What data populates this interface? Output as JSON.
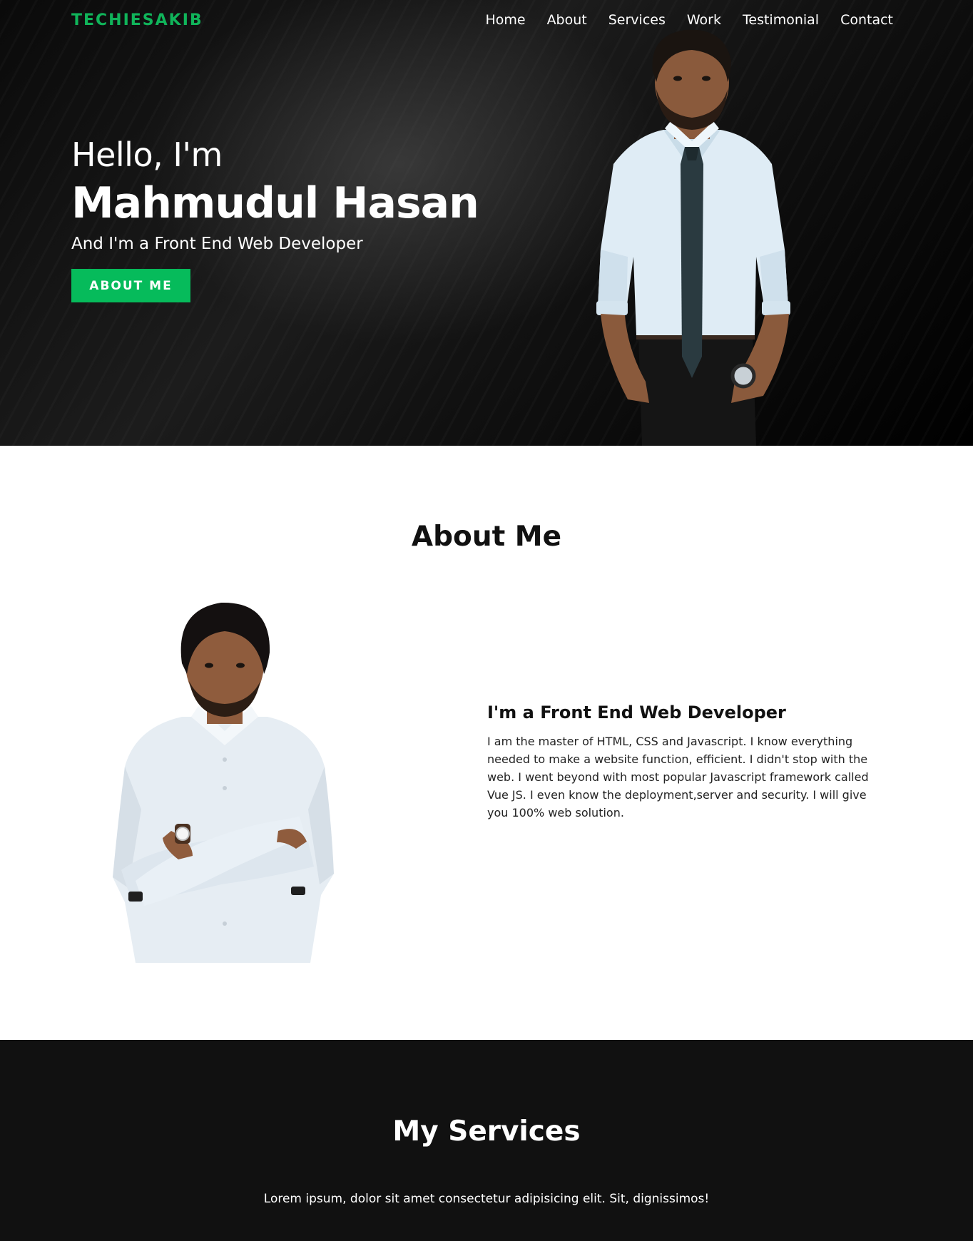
{
  "brand": {
    "logo": "TECHIESAKIB",
    "accent_color": "#06bb5b"
  },
  "nav": {
    "items": [
      {
        "label": "Home"
      },
      {
        "label": "About"
      },
      {
        "label": "Services"
      },
      {
        "label": "Work"
      },
      {
        "label": "Testimonial"
      },
      {
        "label": "Contact"
      }
    ]
  },
  "hero": {
    "greeting": "Hello, I'm",
    "name": "Mahmudul Hasan",
    "role": "And I'm a Front End Web Developer",
    "button_label": "ABOUT ME"
  },
  "about": {
    "title": "About Me",
    "heading": "I'm a Front End Web Developer",
    "paragraph": "I am the master of HTML, CSS and Javascript. I know everything needed to make a website function, efficient. I didn't stop with the web. I went beyond with most popular Javascript framework called Vue JS. I even know the deployment,server and security. I will give you 100% web solution."
  },
  "services": {
    "title": "My Services",
    "subtitle": "Lorem ipsum, dolor sit amet consectetur adipisicing elit. Sit, dignissimos!"
  }
}
